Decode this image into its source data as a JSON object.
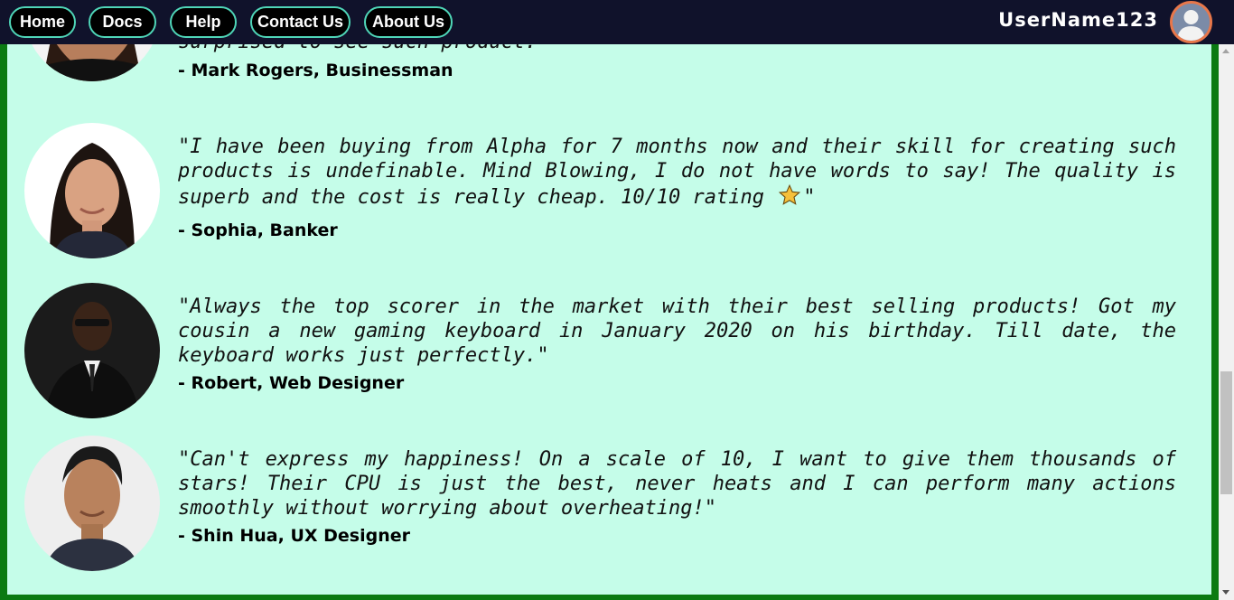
{
  "nav": {
    "items": [
      {
        "label": "Home"
      },
      {
        "label": "Docs"
      },
      {
        "label": "Help"
      },
      {
        "label": "Contact Us"
      },
      {
        "label": "About Us"
      }
    ],
    "username": "UserName123",
    "avatar_icon": "user-silhouette-icon"
  },
  "colors": {
    "panel_bg": "#c5fde9",
    "border_green": "#0b7a12",
    "topbar_bg": "#10122b",
    "nav_border": "#4fd6b8",
    "star": "#f5c03a"
  },
  "testimonials": [
    {
      "quote": "surprised to see such product.\"",
      "author": "- Mark Rogers, Businessman"
    },
    {
      "quote_before_star": "\"I have been buying from Alpha for 7 months now and their skill for creating such products is undefinable. Mind Blowing, I do not have words to say! The quality is superb and the cost is really cheap. 10/10 rating",
      "quote_after_star": "\"",
      "star_icon": "star-icon",
      "author": "- Sophia, Banker"
    },
    {
      "quote": "\"Always the top scorer in the market with their best selling products! Got my cousin a new gaming keyboard in January 2020 on his birthday. Till date, the keyboard works just perfectly.\"",
      "author": "- Robert, Web Designer"
    },
    {
      "quote": "\"Can't express my happiness! On a scale of 10, I want to give them thousands of stars! Their CPU is just the best, never heats and I can perform many actions smoothly without worrying about overheating!\"",
      "author": "- Shin Hua, UX Designer"
    }
  ]
}
